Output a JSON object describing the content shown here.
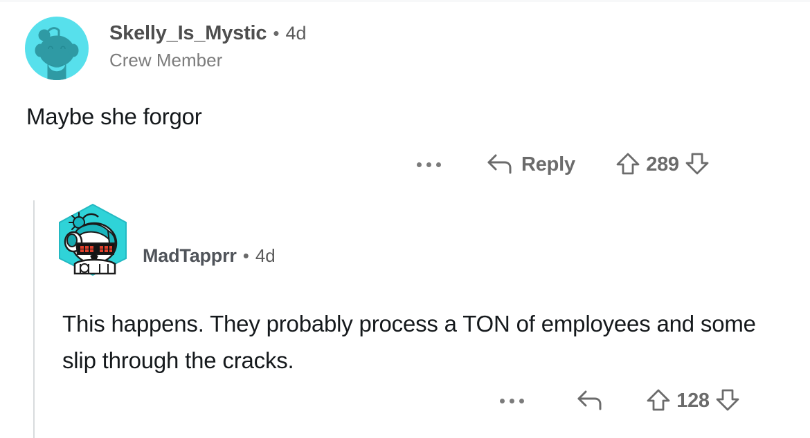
{
  "thread": {
    "comments": [
      {
        "id": "root-comment",
        "author": "Skelly_Is_Mystic",
        "separator": "•",
        "timestamp": "4d",
        "flair": "Crew Member",
        "body": "Maybe she forgor",
        "avatar": {
          "name": "snoo-avatar",
          "background_color": "#57e0ec",
          "figure_color": "#2d9fa8"
        },
        "actions": {
          "overflow": "more-options-icon",
          "reply_icon": "reply-arrow-icon",
          "reply_label": "Reply",
          "upvote_icon": "upvote-arrow-icon",
          "vote_count": "289",
          "downvote_icon": "downvote-arrow-icon"
        }
      },
      {
        "id": "nested-reply",
        "author": "MadTapprr",
        "separator": "•",
        "timestamp": "4d",
        "flair": "",
        "body": "This happens.  They probably process a TON of employees and some slip through the cracks.",
        "avatar": {
          "name": "robot-snoo-avatar",
          "background_color": "#2fd3d8",
          "figure_color": "#17a8ae"
        },
        "actions": {
          "overflow": "more-options-icon",
          "reply_icon": "reply-arrow-icon",
          "reply_label": "",
          "upvote_icon": "upvote-arrow-icon",
          "vote_count": "128",
          "downvote_icon": "downvote-arrow-icon"
        }
      }
    ]
  },
  "colors": {
    "page_background": "#ffffff",
    "body_text": "#15191c",
    "username_text": "#4e4e4e",
    "muted_text": "#7c7c7c",
    "action_icon": "#6b6b6b",
    "thread_line": "#d8dbdd"
  }
}
